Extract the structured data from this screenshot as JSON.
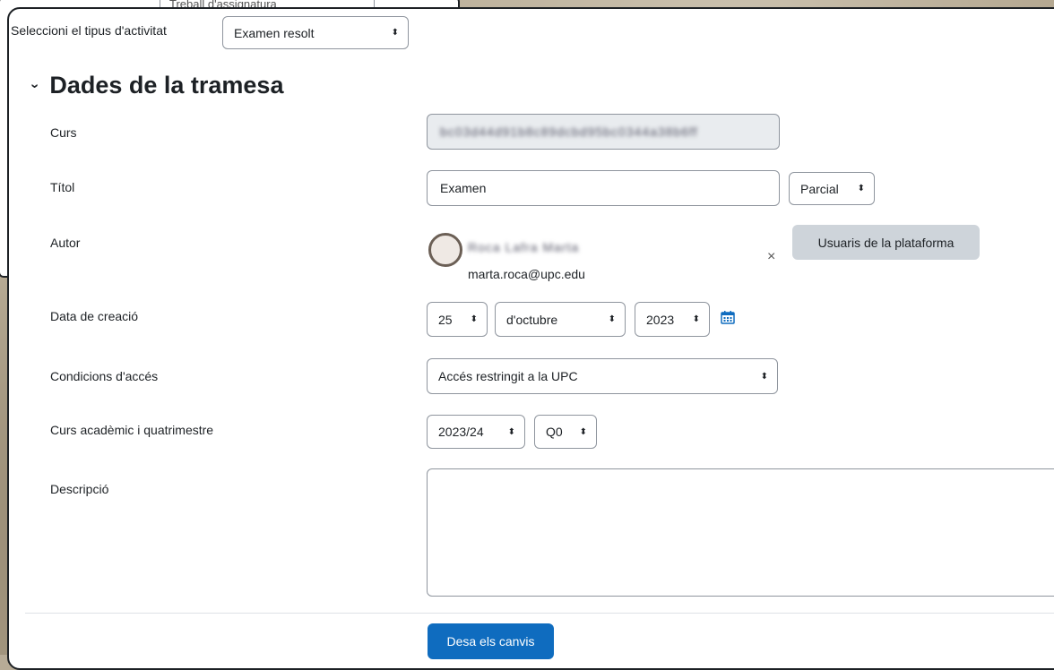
{
  "background_dropdown_text": "Treball d'assignatura",
  "activity_type": {
    "label": "Seleccioni el tipus d'activitat",
    "value": "Examen resolt"
  },
  "section": {
    "title": "Dades de la tramesa"
  },
  "fields": {
    "curs": {
      "label": "Curs",
      "value": "bc03d44d91b8c89dcbd95bc0344a38b6ff"
    },
    "titol": {
      "label": "Títol",
      "value": "Examen",
      "type_value": "Parcial"
    },
    "autor": {
      "label": "Autor",
      "name": "Roca Lafra Marta",
      "email": "marta.roca@upc.edu",
      "users_button": "Usuaris de la plataforma",
      "remove_symbol": "×"
    },
    "data_creacio": {
      "label": "Data de creació",
      "day": "25",
      "month": "d'octubre",
      "year": "2023"
    },
    "condicions": {
      "label": "Condicions d'accés",
      "value": "Accés restringit a la UPC"
    },
    "curs_academic": {
      "label": "Curs acadèmic i quatrimestre",
      "year": "2023/24",
      "quarter": "Q0"
    },
    "descripcio": {
      "label": "Descripció",
      "value": ""
    }
  },
  "save_button": "Desa els canvis",
  "icons": {
    "dropdown_arrow": "⬍",
    "section_toggle": "chevron-down-icon",
    "calendar": "calendar-icon"
  },
  "colors": {
    "primary": "#0f6cbf",
    "secondary_button": "#ced4da",
    "disabled_input": "#e9ecef",
    "calendar": "#0f6cbf"
  }
}
